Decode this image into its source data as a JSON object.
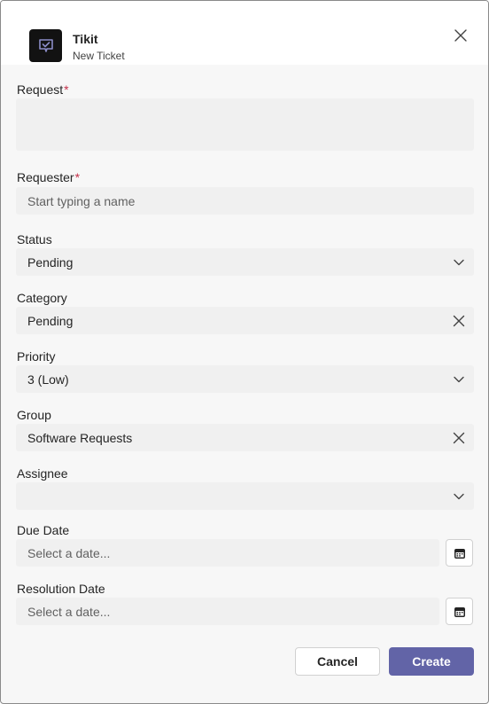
{
  "app": {
    "name": "Tikit",
    "subtitle": "New Ticket",
    "accent_color": "#6264a7",
    "logo_icon": "chat-check-icon"
  },
  "required_marker": "*",
  "form": {
    "request": {
      "label": "Request",
      "value": ""
    },
    "requester": {
      "label": "Requester",
      "placeholder": "Start typing a name"
    },
    "status": {
      "label": "Status",
      "value": "Pending",
      "icon": "chevron-down-icon"
    },
    "category": {
      "label": "Category",
      "value": "Pending",
      "icon": "clear-icon"
    },
    "priority": {
      "label": "Priority",
      "value": "3 (Low)",
      "icon": "chevron-down-icon"
    },
    "group": {
      "label": "Group",
      "value": "Software Requests",
      "icon": "clear-icon"
    },
    "assignee": {
      "label": "Assignee",
      "value": "",
      "icon": "chevron-down-icon"
    },
    "due_date": {
      "label": "Due Date",
      "placeholder": "Select a date...",
      "icon": "calendar-icon"
    },
    "resolution_date": {
      "label": "Resolution Date",
      "placeholder": "Select a date...",
      "icon": "calendar-icon"
    }
  },
  "actions": {
    "cancel_label": "Cancel",
    "create_label": "Create"
  }
}
